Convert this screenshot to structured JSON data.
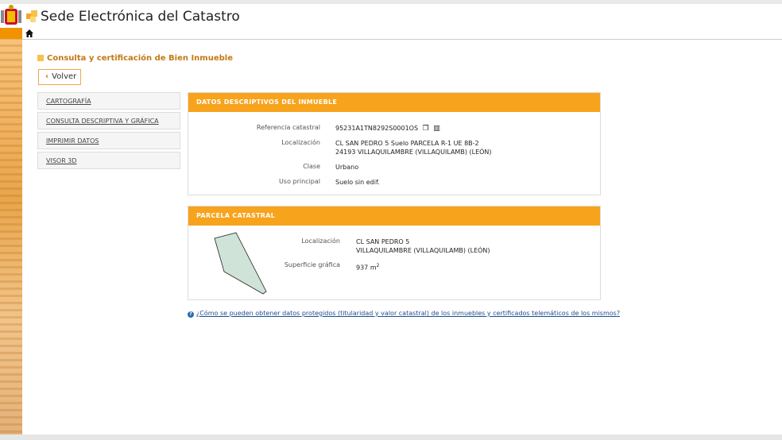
{
  "header": {
    "site_title": "Sede Electrónica del Catastro"
  },
  "page": {
    "heading": "Consulta y certificación de Bien Inmueble",
    "back_button": "Volver"
  },
  "side_menu": {
    "items": [
      {
        "label": "CARTOGRAFÍA"
      },
      {
        "label": "CONSULTA DESCRIPTIVA Y GRÁFICA"
      },
      {
        "label": "IMPRIMIR DATOS"
      },
      {
        "label": "VISOR 3D"
      }
    ]
  },
  "datos": {
    "title": "DATOS DESCRIPTIVOS DEL INMUEBLE",
    "ref_label": "Referencia catastral",
    "ref_value": "95231A1TN8292S0001OS",
    "loc_label": "Localización",
    "loc_line1": "CL SAN PEDRO 5 Suelo PARCELA R-1 UE 8B-2",
    "loc_line2": "24193 VILLAQUILAMBRE (VILLAQUILAMB) (LEÓN)",
    "clase_label": "Clase",
    "clase_value": "Urbano",
    "uso_label": "Uso principal",
    "uso_value": "Suelo sin edif."
  },
  "parcela": {
    "title": "PARCELA CATASTRAL",
    "loc_label": "Localización",
    "loc_line1": "CL SAN PEDRO 5",
    "loc_line2": "VILLAQUILAMBRE (VILLAQUILAMB) (LEÓN)",
    "sup_label": "Superficie gráfica",
    "sup_value": "937 m",
    "sup_exp": "2"
  },
  "help_link": "¿Cómo se pueden obtener datos protegidos (titularidad y valor catastral) de los inmuebles y certificados telemáticos de los mismos?",
  "colors": {
    "accent": "#f7a31c",
    "brand_orange": "#f39200",
    "link": "#1f4f8f"
  }
}
